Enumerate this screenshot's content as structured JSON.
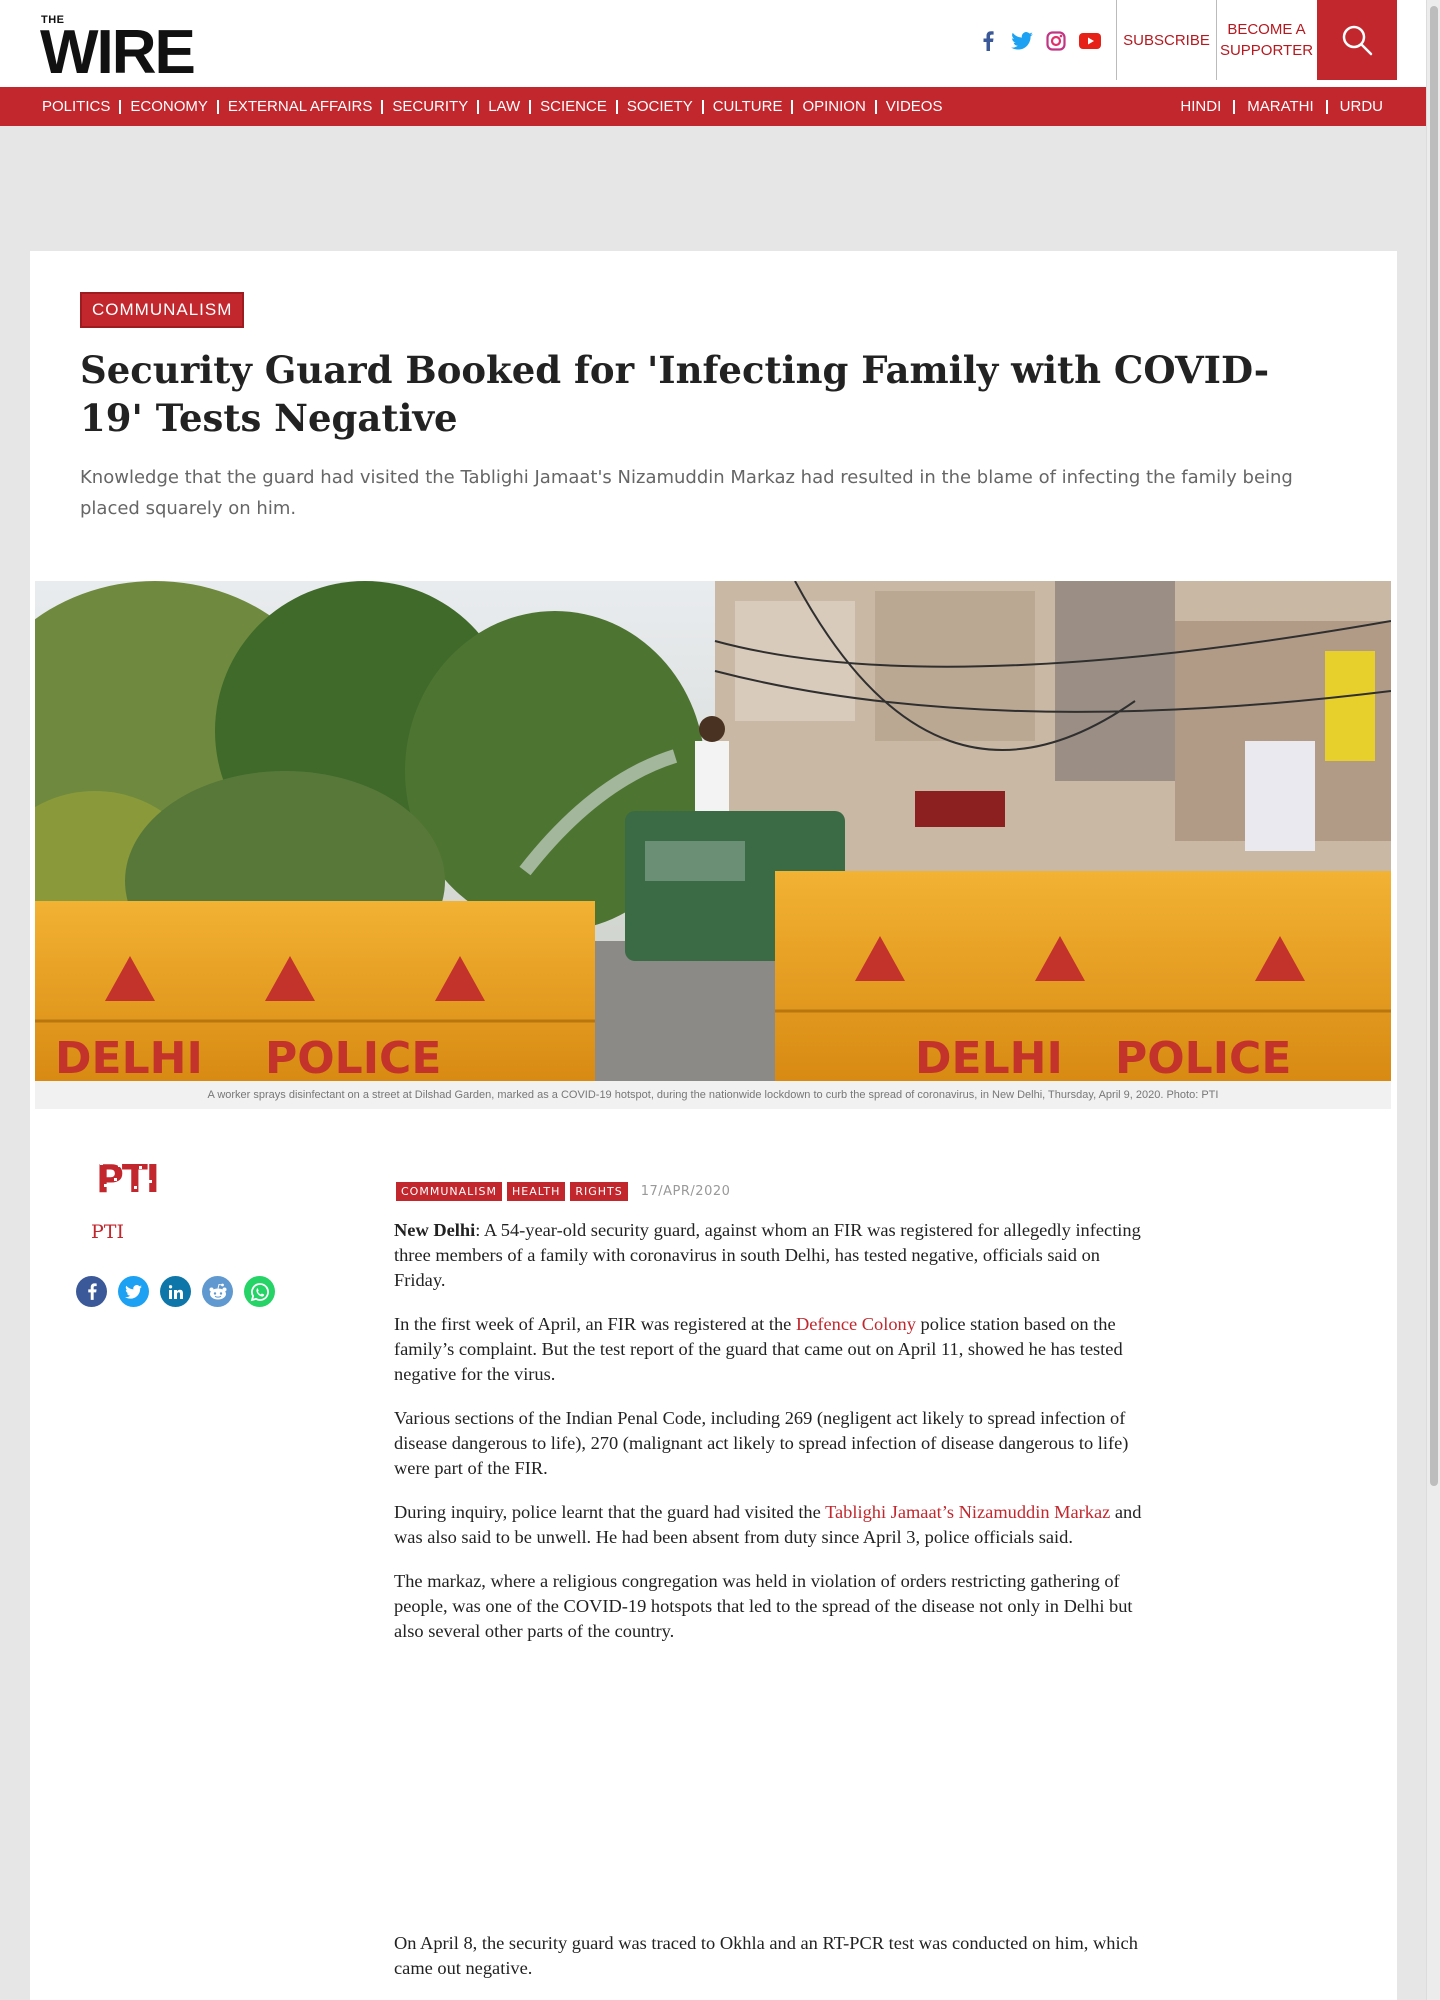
{
  "header": {
    "logo_small": "THE",
    "logo_big": "WIRE",
    "subscribe_label": "SUBSCRIBE",
    "support_label_line1": "BECOME A",
    "support_label_line2": "SUPPORTER",
    "social_icons": [
      "facebook-icon",
      "twitter-icon",
      "instagram-icon",
      "youtube-icon"
    ]
  },
  "nav": {
    "items": [
      "POLITICS",
      "ECONOMY",
      "EXTERNAL AFFAIRS",
      "SECURITY",
      "LAW",
      "SCIENCE",
      "SOCIETY",
      "CULTURE",
      "OPINION",
      "VIDEOS"
    ],
    "languages": [
      "HINDI",
      "MARATHI",
      "URDU"
    ]
  },
  "article": {
    "category": "COMMUNALISM",
    "title": "Security Guard Booked for 'Infecting Family with COVID-19' Tests Negative",
    "deck": "Knowledge that the guard had visited the Tablighi Jamaat's Nizamuddin Markaz had resulted in the blame of infecting the family being placed squarely on him.",
    "image_caption": "A worker sprays disinfectant on a street at Dilshad Garden, marked as a COVID-19 hotspot, during the nationwide lockdown to curb the spread of coronavirus, in New Delhi, Thursday, April 9, 2020. Photo: PTI",
    "hero_barricade_text": [
      "DELHI",
      "POLICE",
      "DELHI",
      "POLICE"
    ],
    "author_logo_text": "PTI",
    "author": "PTI",
    "tags": [
      "COMMUNALISM",
      "HEALTH",
      "RIGHTS"
    ],
    "date": "17/APR/2020",
    "paragraphs": {
      "p1_lead": "New Delhi",
      "p1_rest": ": A 54-year-old security guard, against whom an FIR was registered for allegedly infecting three members of a family with coronavirus in south Delhi, has tested negative, officials said on Friday.",
      "p2_a": "In the first week of April, an FIR was registered at the ",
      "p2_link": "Defence Colony",
      "p2_b": " police station based on the family’s complaint. But the test report of the guard that came out on April 11, showed he has tested negative for the virus.",
      "p3": "Various sections of the Indian Penal Code, including 269 (negligent act likely to spread infection of disease dangerous to life), 270 (malignant act likely to spread infection of disease dangerous to life) were part of the FIR.",
      "p4_a": "During inquiry, police learnt that the guard had visited the ",
      "p4_link": "Tablighi Jamaat’s Nizamuddin Markaz",
      "p4_b": " and was also said to be unwell. He had been absent from duty since April 3, police officials said.",
      "p5": "The markaz, where a religious congregation was held in violation of orders restricting gathering of people, was one of the COVID-19 hotspots that led to the spread of the disease not only in Delhi but also several other parts of the country.",
      "p6": "On April 8, the security guard was traced to Okhla and an RT-PCR test was conducted on him, which came out negative."
    }
  },
  "share_icons": [
    "facebook-share-icon",
    "twitter-share-icon",
    "linkedin-share-icon",
    "reddit-share-icon",
    "whatsapp-share-icon"
  ],
  "colors": {
    "brand_red": "#c1272d",
    "text": "#222222",
    "muted": "#666666"
  }
}
